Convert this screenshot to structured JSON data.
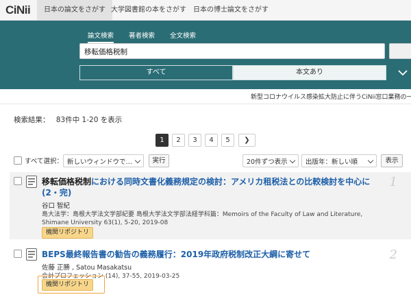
{
  "brand": {
    "logo": "CiNii"
  },
  "topnav": {
    "items": [
      {
        "label": "日本の論文をさがす"
      },
      {
        "label": "大学図書館の本をさがす"
      },
      {
        "label": "日本の博士論文をさがす"
      }
    ]
  },
  "search": {
    "tabs": [
      {
        "label": "論文検索"
      },
      {
        "label": "著者検索"
      },
      {
        "label": "全文検索"
      }
    ],
    "value": "移転価格税制",
    "segments": [
      {
        "label": "すべて"
      },
      {
        "label": "本文あり"
      }
    ]
  },
  "notice": {
    "text": "新型コロナウイルス感染拡大防止に伴うCiNii窓口業務の一"
  },
  "results_summary": {
    "label": "検索結果：",
    "count": "83件中 1-20 を表示"
  },
  "pagination": {
    "pages": [
      "1",
      "2",
      "3",
      "4",
      "5"
    ],
    "current": "1",
    "next": "❯"
  },
  "toolbar": {
    "select_all": "すべて選択：",
    "window_select": "新しいウィンドウで…",
    "run": "実行",
    "per_page": "20件ずつ表示",
    "sort": "出版年：新しい順",
    "show": "表示"
  },
  "results": [
    {
      "number": "1",
      "title_highlight": "移転価格税制",
      "title_rest": "における同時文書化義務規定の検討：アメリカ租税法との比較検討を中心に(2・完)",
      "author": "谷口 智紀",
      "publication": "島大法学：島根大学法文学部紀要 島根大学法文学部法経学科篇：Memoirs of the Faculty of Law and Literature, Shimane University 63(1), 5-20, 2019-08",
      "badge": "機関リポジトリ"
    },
    {
      "number": "2",
      "title_highlight": "",
      "title_rest": "BEPS最終報告書の勧告の義務履行：2019年政府税制改正大綱に寄せて",
      "author": "佐藤 正勝 , Satou Masakatsu",
      "publication": "会計プロフェッション (14), 37-55, 2019-03-25",
      "badge": "機関リポジトリ"
    }
  ],
  "colors": {
    "header_bg": "#2b6d75",
    "link": "#1d5fa8",
    "badge": "#f7d68b",
    "highlight_box": "#f2a33a"
  }
}
